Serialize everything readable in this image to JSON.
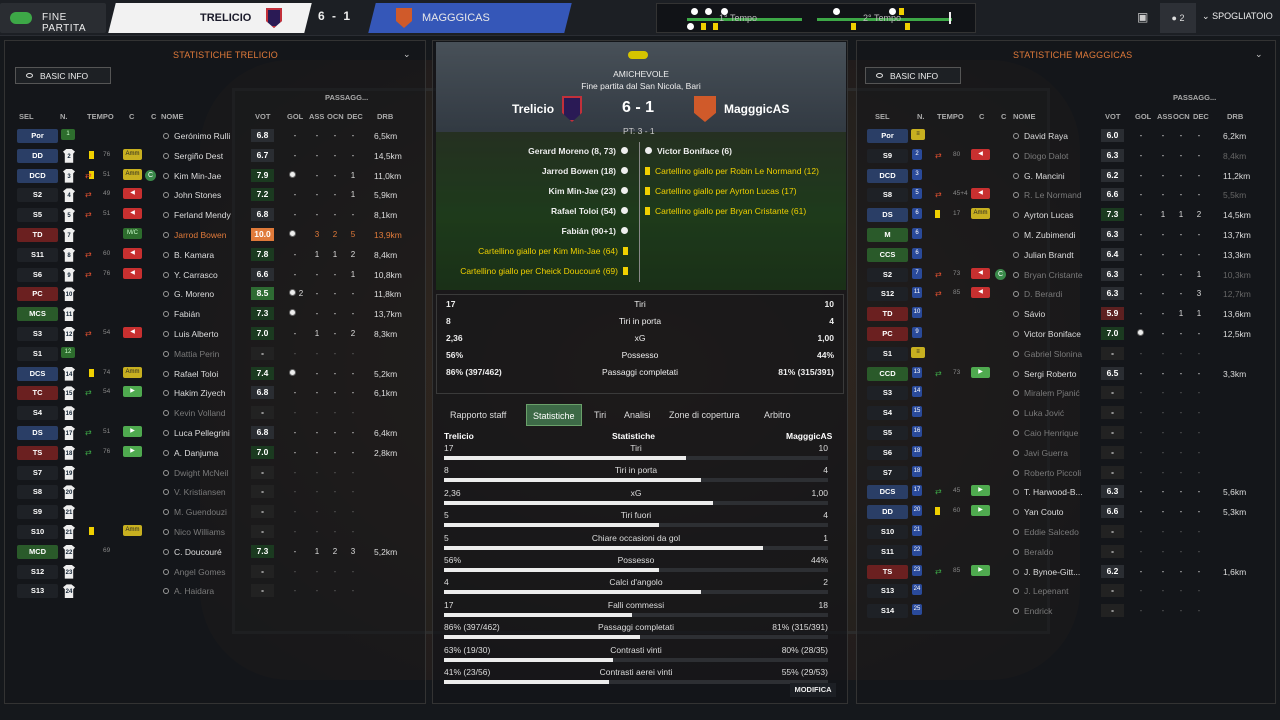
{
  "topbar": {
    "status": "FINE PARTITA",
    "home_team": "TRELICIO",
    "score": "6 - 1",
    "away_team": "MAGGGICAS",
    "first_half": "1° Tempo",
    "second_half": "2° Tempo",
    "badge_count": "2",
    "dressing_room": "SPOGLIATOIO"
  },
  "colors": {
    "home_crest": "#2a1a55",
    "away_crest": "#d05a2a",
    "accent": "#e07a3a"
  },
  "left_panel": {
    "title": "STATISTICHE TRELICIO",
    "button": "BASIC INFO",
    "passes_group": "PASSAGG...",
    "headers": [
      "SEL",
      "N.",
      "TEMPO",
      "C",
      "C",
      "NOME",
      "VOT",
      "GOL",
      "ASS",
      "OCN",
      "DEC",
      "DRB"
    ],
    "rows": [
      {
        "pos": "Por",
        "num": "1",
        "min": "",
        "name": "Gerónimo Rulli",
        "rating": "6.8",
        "gol": "-",
        "ass": "-",
        "ocn": "-",
        "dec": "-",
        "km": "6,5km"
      },
      {
        "pos": "DD",
        "num": "2",
        "min": "76",
        "name": "Sergiño Dest",
        "rating": "6.7",
        "gol": "-",
        "ass": "-",
        "ocn": "-",
        "dec": "-",
        "km": "14,5km"
      },
      {
        "pos": "DCD",
        "num": "3",
        "min": "51",
        "name": "Kim Min-Jae",
        "rating": "7.9",
        "gol": "1",
        "ass": "-",
        "ocn": "-",
        "dec": "1",
        "km": "11,0km"
      },
      {
        "pos": "S2",
        "num": "4",
        "min": "49",
        "name": "John Stones",
        "rating": "7.2",
        "gol": "-",
        "ass": "-",
        "ocn": "-",
        "dec": "1",
        "km": "5,9km"
      },
      {
        "pos": "S5",
        "num": "5",
        "min": "51",
        "name": "Ferland Mendy",
        "rating": "6.8",
        "gol": "-",
        "ass": "-",
        "ocn": "-",
        "dec": "-",
        "km": "8,1km"
      },
      {
        "pos": "TD",
        "num": "7",
        "min": "",
        "name": "Jarrod Bowen",
        "rating": "10.0",
        "gol": "1",
        "ass": "3",
        "ocn": "2",
        "dec": "5",
        "km": "13,9km"
      },
      {
        "pos": "S11",
        "num": "8",
        "min": "60",
        "name": "B. Kamara",
        "rating": "7.8",
        "gol": "-",
        "ass": "1",
        "ocn": "1",
        "dec": "2",
        "km": "8,4km"
      },
      {
        "pos": "S6",
        "num": "9",
        "min": "76",
        "name": "Y. Carrasco",
        "rating": "6.6",
        "gol": "-",
        "ass": "-",
        "ocn": "-",
        "dec": "1",
        "km": "10,8km"
      },
      {
        "pos": "PC",
        "num": "10",
        "min": "",
        "name": "G. Moreno",
        "rating": "8.5",
        "gol": "2",
        "ass": "-",
        "ocn": "-",
        "dec": "-",
        "km": "11,8km"
      },
      {
        "pos": "MCS",
        "num": "11",
        "min": "",
        "name": "Fabián",
        "rating": "7.3",
        "gol": "1",
        "ass": "-",
        "ocn": "-",
        "dec": "-",
        "km": "13,7km"
      },
      {
        "pos": "S3",
        "num": "12",
        "min": "54",
        "name": "Luis Alberto",
        "rating": "7.0",
        "gol": "-",
        "ass": "1",
        "ocn": "-",
        "dec": "2",
        "km": "8,3km"
      },
      {
        "pos": "S1",
        "num": "12",
        "min": "",
        "name": "Mattia Perin",
        "rating": "-",
        "gol": "-",
        "ass": "-",
        "ocn": "-",
        "dec": "-",
        "km": ""
      },
      {
        "pos": "DCS",
        "num": "14",
        "min": "74",
        "name": "Rafael Toloi",
        "rating": "7.4",
        "gol": "1",
        "ass": "-",
        "ocn": "-",
        "dec": "-",
        "km": "5,2km"
      },
      {
        "pos": "TC",
        "num": "15",
        "min": "54",
        "name": "Hakim Ziyech",
        "rating": "6.8",
        "gol": "-",
        "ass": "-",
        "ocn": "-",
        "dec": "-",
        "km": "6,1km"
      },
      {
        "pos": "S4",
        "num": "16",
        "min": "",
        "name": "Kevin Volland",
        "rating": "-",
        "gol": "-",
        "ass": "-",
        "ocn": "-",
        "dec": "-",
        "km": ""
      },
      {
        "pos": "DS",
        "num": "17",
        "min": "51",
        "name": "Luca Pellegrini",
        "rating": "6.8",
        "gol": "-",
        "ass": "-",
        "ocn": "-",
        "dec": "-",
        "km": "6,4km"
      },
      {
        "pos": "TS",
        "num": "18",
        "min": "76",
        "name": "A. Danjuma",
        "rating": "7.0",
        "gol": "-",
        "ass": "-",
        "ocn": "-",
        "dec": "-",
        "km": "2,8km"
      },
      {
        "pos": "S7",
        "num": "19",
        "min": "",
        "name": "Dwight McNeil",
        "rating": "-",
        "gol": "-",
        "ass": "-",
        "ocn": "-",
        "dec": "-",
        "km": ""
      },
      {
        "pos": "S8",
        "num": "20",
        "min": "",
        "name": "V. Kristiansen",
        "rating": "-",
        "gol": "-",
        "ass": "-",
        "ocn": "-",
        "dec": "-",
        "km": ""
      },
      {
        "pos": "S9",
        "num": "21",
        "min": "",
        "name": "M. Guendouzi",
        "rating": "-",
        "gol": "-",
        "ass": "-",
        "ocn": "-",
        "dec": "-",
        "km": ""
      },
      {
        "pos": "S10",
        "num": "21",
        "min": "",
        "name": "Nico Williams",
        "rating": "-",
        "gol": "-",
        "ass": "-",
        "ocn": "-",
        "dec": "-",
        "km": ""
      },
      {
        "pos": "MCD",
        "num": "22",
        "min": "69",
        "name": "C. Doucouré",
        "rating": "7.3",
        "gol": "-",
        "ass": "1",
        "ocn": "2",
        "dec": "3",
        "km": "5,2km"
      },
      {
        "pos": "S12",
        "num": "23",
        "min": "",
        "name": "Angel Gomes",
        "rating": "-",
        "gol": "-",
        "ass": "-",
        "ocn": "-",
        "dec": "-",
        "km": ""
      },
      {
        "pos": "S13",
        "num": "24",
        "min": "",
        "name": "A. Haidara",
        "rating": "-",
        "gol": "-",
        "ass": "-",
        "ocn": "-",
        "dec": "-",
        "km": ""
      }
    ]
  },
  "right_panel": {
    "title": "STATISTICHE MAGGGICAS",
    "button": "BASIC INFO",
    "passes_group": "PASSAGG...",
    "headers": [
      "SEL",
      "N.",
      "TEMPO",
      "C",
      "C",
      "NOME",
      "VOT",
      "GOL",
      "ASS",
      "OCN",
      "DEC",
      "DRB"
    ],
    "rows": [
      {
        "pos": "Por",
        "num": "",
        "min": "",
        "name": "David Raya",
        "rating": "6.0",
        "gol": "-",
        "ass": "-",
        "ocn": "-",
        "dec": "-",
        "km": "6,2km"
      },
      {
        "pos": "S9",
        "num": "2",
        "min": "80",
        "name": "Diogo Dalot",
        "rating": "6.3",
        "gol": "-",
        "ass": "-",
        "ocn": "-",
        "dec": "-",
        "km": "8,4km"
      },
      {
        "pos": "DCD",
        "num": "3",
        "min": "",
        "name": "G. Mancini",
        "rating": "6.2",
        "gol": "-",
        "ass": "-",
        "ocn": "-",
        "dec": "-",
        "km": "11,2km"
      },
      {
        "pos": "S8",
        "num": "5",
        "min": "45+4",
        "name": "R. Le Normand",
        "rating": "6.6",
        "gol": "-",
        "ass": "-",
        "ocn": "-",
        "dec": "-",
        "km": "5,5km"
      },
      {
        "pos": "DS",
        "num": "6",
        "min": "17",
        "name": "Ayrton Lucas",
        "rating": "7.3",
        "gol": "-",
        "ass": "1",
        "ocn": "1",
        "dec": "2",
        "km": "14,5km"
      },
      {
        "pos": "M",
        "num": "6",
        "min": "",
        "name": "M. Zubimendi",
        "rating": "6.3",
        "gol": "-",
        "ass": "-",
        "ocn": "-",
        "dec": "-",
        "km": "13,7km"
      },
      {
        "pos": "CCS",
        "num": "6",
        "min": "",
        "name": "Julian Brandt",
        "rating": "6.4",
        "gol": "-",
        "ass": "-",
        "ocn": "-",
        "dec": "-",
        "km": "13,3km"
      },
      {
        "pos": "S2",
        "num": "7",
        "min": "73",
        "name": "Bryan Cristante",
        "rating": "6.3",
        "gol": "-",
        "ass": "-",
        "ocn": "-",
        "dec": "1",
        "km": "10,3km"
      },
      {
        "pos": "S12",
        "num": "11",
        "min": "85",
        "name": "D. Berardi",
        "rating": "6.3",
        "gol": "-",
        "ass": "-",
        "ocn": "-",
        "dec": "3",
        "km": "12,7km"
      },
      {
        "pos": "TD",
        "num": "10",
        "min": "",
        "name": "Sávio",
        "rating": "5.9",
        "gol": "-",
        "ass": "-",
        "ocn": "1",
        "dec": "1",
        "km": "13,6km"
      },
      {
        "pos": "PC",
        "num": "9",
        "min": "",
        "name": "Victor Boniface",
        "rating": "7.0",
        "gol": "1",
        "ass": "-",
        "ocn": "-",
        "dec": "-",
        "km": "12,5km"
      },
      {
        "pos": "S1",
        "num": "",
        "min": "",
        "name": "Gabriel Slonina",
        "rating": "-",
        "gol": "-",
        "ass": "-",
        "ocn": "-",
        "dec": "-",
        "km": ""
      },
      {
        "pos": "CCD",
        "num": "13",
        "min": "73",
        "name": "Sergi Roberto",
        "rating": "6.5",
        "gol": "-",
        "ass": "-",
        "ocn": "-",
        "dec": "-",
        "km": "3,3km"
      },
      {
        "pos": "S3",
        "num": "14",
        "min": "",
        "name": "Miralem Pjanić",
        "rating": "-",
        "gol": "-",
        "ass": "-",
        "ocn": "-",
        "dec": "-",
        "km": ""
      },
      {
        "pos": "S4",
        "num": "15",
        "min": "",
        "name": "Luka Jović",
        "rating": "-",
        "gol": "-",
        "ass": "-",
        "ocn": "-",
        "dec": "-",
        "km": ""
      },
      {
        "pos": "S5",
        "num": "16",
        "min": "",
        "name": "Caio Henrique",
        "rating": "-",
        "gol": "-",
        "ass": "-",
        "ocn": "-",
        "dec": "-",
        "km": ""
      },
      {
        "pos": "S6",
        "num": "18",
        "min": "",
        "name": "Javi Guerra",
        "rating": "-",
        "gol": "-",
        "ass": "-",
        "ocn": "-",
        "dec": "-",
        "km": ""
      },
      {
        "pos": "S7",
        "num": "18",
        "min": "",
        "name": "Roberto Piccoli",
        "rating": "-",
        "gol": "-",
        "ass": "-",
        "ocn": "-",
        "dec": "-",
        "km": ""
      },
      {
        "pos": "DCS",
        "num": "17",
        "min": "45",
        "name": "T. Harwood-B...",
        "rating": "6.3",
        "gol": "-",
        "ass": "-",
        "ocn": "-",
        "dec": "-",
        "km": "5,6km"
      },
      {
        "pos": "DD",
        "num": "20",
        "min": "60",
        "name": "Yan Couto",
        "rating": "6.6",
        "gol": "-",
        "ass": "-",
        "ocn": "-",
        "dec": "-",
        "km": "5,3km"
      },
      {
        "pos": "S10",
        "num": "21",
        "min": "",
        "name": "Eddie Salcedo",
        "rating": "-",
        "gol": "-",
        "ass": "-",
        "ocn": "-",
        "dec": "-",
        "km": ""
      },
      {
        "pos": "S11",
        "num": "22",
        "min": "",
        "name": "Beraldo",
        "rating": "-",
        "gol": "-",
        "ass": "-",
        "ocn": "-",
        "dec": "-",
        "km": ""
      },
      {
        "pos": "TS",
        "num": "23",
        "min": "85",
        "name": "J. Bynoe-Gitt...",
        "rating": "6.2",
        "gol": "-",
        "ass": "-",
        "ocn": "-",
        "dec": "-",
        "km": "1,6km"
      },
      {
        "pos": "S13",
        "num": "24",
        "min": "",
        "name": "J. Lepenant",
        "rating": "-",
        "gol": "-",
        "ass": "-",
        "ocn": "-",
        "dec": "-",
        "km": ""
      },
      {
        "pos": "S14",
        "num": "25",
        "min": "",
        "name": "Endrick",
        "rating": "-",
        "gol": "-",
        "ass": "-",
        "ocn": "-",
        "dec": "-",
        "km": ""
      }
    ]
  },
  "match": {
    "competition": "AMICHEVOLE",
    "venue": "Fine partita dal San Nicola, Bari",
    "home": "Trelicio",
    "away": "MagggicAS",
    "score": "6 - 1",
    "halftime": "PT: 3 - 1",
    "home_events": [
      "Gerard Moreno (8, 73)",
      "Jarrod Bowen (18)",
      "Kim Min-Jae (23)",
      "Rafael Toloi (54)",
      "Fabián (90+1)",
      "Cartellino giallo per Kim Min-Jae (64)",
      "Cartellino giallo per Cheick Doucouré (69)"
    ],
    "away_events": [
      "Victor Boniface (6)",
      "Cartellino giallo per Robin Le Normand (12)",
      "Cartellino giallo per Ayrton Lucas (17)",
      "Cartellino giallo per Bryan Cristante (61)"
    ]
  },
  "summary_stats": [
    {
      "home": "17",
      "label": "Tiri",
      "away": "10"
    },
    {
      "home": "8",
      "label": "Tiri in porta",
      "away": "4"
    },
    {
      "home": "2,36",
      "label": "xG",
      "away": "1,00"
    },
    {
      "home": "56%",
      "label": "Possesso",
      "away": "44%"
    },
    {
      "home": "86% (397/462)",
      "label": "Passaggi completati",
      "away": "81% (315/391)"
    }
  ],
  "tabs": [
    "Rapporto staff",
    "Statistiche",
    "Tiri",
    "Analisi",
    "Zone di copertura",
    "Arbitro"
  ],
  "comparison": {
    "home": "Trelicio",
    "title": "Statistiche",
    "away": "MagggicAS",
    "rows": [
      {
        "home": "17",
        "label": "Tiri",
        "away": "10",
        "home_share": 0.63
      },
      {
        "home": "8",
        "label": "Tiri in porta",
        "away": "4",
        "home_share": 0.67
      },
      {
        "home": "2,36",
        "label": "xG",
        "away": "1,00",
        "home_share": 0.7
      },
      {
        "home": "5",
        "label": "Tiri fuori",
        "away": "4",
        "home_share": 0.56
      },
      {
        "home": "5",
        "label": "Chiare occasioni da gol",
        "away": "1",
        "home_share": 0.83
      },
      {
        "home": "56%",
        "label": "Possesso",
        "away": "44%",
        "home_share": 0.56
      },
      {
        "home": "4",
        "label": "Calci d'angolo",
        "away": "2",
        "home_share": 0.67
      },
      {
        "home": "17",
        "label": "Falli commessi",
        "away": "18",
        "home_share": 0.49
      },
      {
        "home": "86% (397/462)",
        "label": "Passaggi completati",
        "away": "81% (315/391)",
        "home_share": 0.51
      },
      {
        "home": "63% (19/30)",
        "label": "Contrasti vinti",
        "away": "80% (28/35)",
        "home_share": 0.44
      },
      {
        "home": "41% (23/56)",
        "label": "Contrasti aerei vinti",
        "away": "55% (29/53)",
        "home_share": 0.43
      }
    ]
  },
  "modifica": "MODIFICA"
}
